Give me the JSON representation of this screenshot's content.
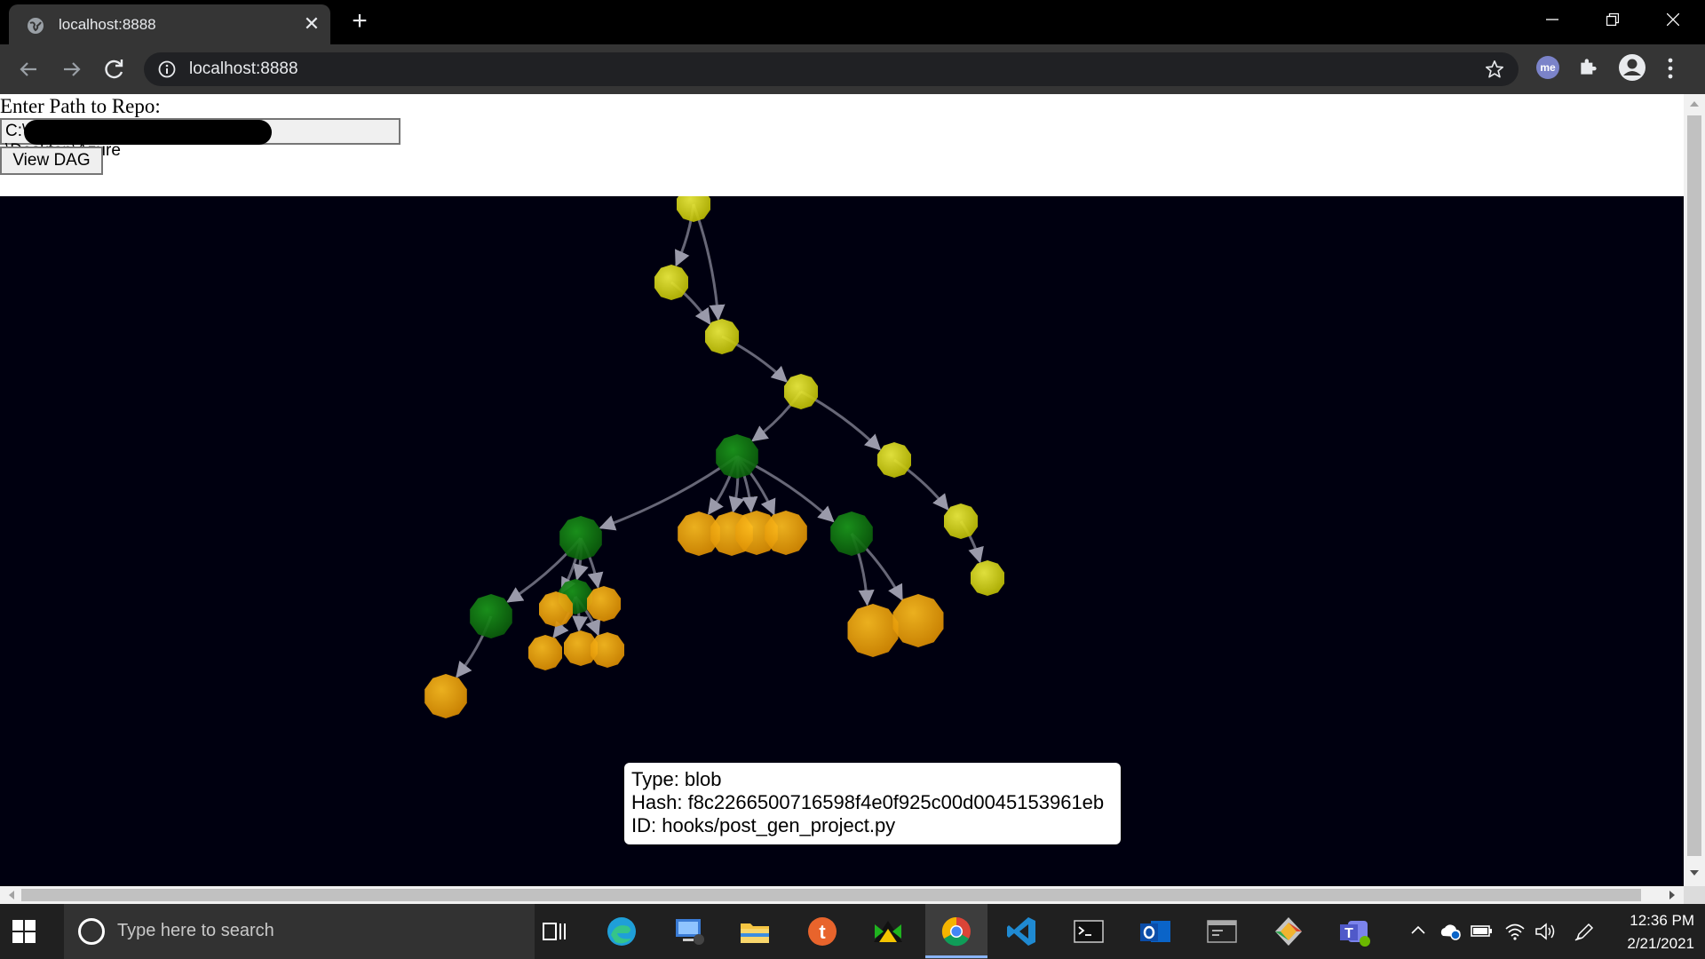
{
  "browser": {
    "tab_title": "localhost:8888",
    "url": "localhost:8888"
  },
  "page": {
    "form_label": "Enter Path to Repo:",
    "path_prefix": "C:\\",
    "path_suffix": "\\Desktop\\Azure",
    "button_label": "View DAG"
  },
  "graph": {
    "nodes": [
      {
        "id": "y1",
        "color": "yellow",
        "size": "small"
      },
      {
        "id": "y2",
        "color": "yellow",
        "size": "small"
      },
      {
        "id": "y3",
        "color": "yellow",
        "size": "small"
      },
      {
        "id": "y4",
        "color": "yellow",
        "size": "small"
      },
      {
        "id": "y5",
        "color": "yellow",
        "size": "small"
      },
      {
        "id": "y6",
        "color": "yellow",
        "size": "small"
      },
      {
        "id": "y7",
        "color": "yellow",
        "size": "small"
      },
      {
        "id": "g1",
        "color": "green",
        "size": "medium"
      },
      {
        "id": "g2",
        "color": "green",
        "size": "medium"
      },
      {
        "id": "g3",
        "color": "green",
        "size": "medium"
      },
      {
        "id": "g4",
        "color": "green",
        "size": "medium"
      },
      {
        "id": "g5",
        "color": "green",
        "size": "small"
      },
      {
        "id": "o1",
        "color": "orange",
        "size": "medium"
      },
      {
        "id": "o2",
        "color": "orange",
        "size": "medium"
      },
      {
        "id": "o3",
        "color": "orange",
        "size": "medium"
      },
      {
        "id": "o4",
        "color": "orange",
        "size": "medium"
      },
      {
        "id": "o5",
        "color": "orange",
        "size": "large"
      },
      {
        "id": "o6",
        "color": "orange",
        "size": "large"
      },
      {
        "id": "o7",
        "color": "orange",
        "size": "small"
      },
      {
        "id": "o8",
        "color": "orange",
        "size": "small"
      },
      {
        "id": "o9",
        "color": "orange",
        "size": "small"
      },
      {
        "id": "o10",
        "color": "orange",
        "size": "small"
      },
      {
        "id": "o11",
        "color": "orange",
        "size": "small"
      },
      {
        "id": "o12",
        "color": "orange",
        "size": "small"
      },
      {
        "id": "o13",
        "color": "orange",
        "size": "medium"
      }
    ],
    "edges": [
      [
        "y1",
        "y2"
      ],
      [
        "y1",
        "y3"
      ],
      [
        "y2",
        "y3"
      ],
      [
        "y3",
        "y4"
      ],
      [
        "y4",
        "g1"
      ],
      [
        "y4",
        "y5"
      ],
      [
        "y5",
        "y6"
      ],
      [
        "y6",
        "y7"
      ],
      [
        "g1",
        "g2"
      ],
      [
        "g1",
        "g3"
      ],
      [
        "g1",
        "o1"
      ],
      [
        "g1",
        "o2"
      ],
      [
        "g1",
        "o3"
      ],
      [
        "g1",
        "o4"
      ],
      [
        "g3",
        "o5"
      ],
      [
        "g3",
        "o6"
      ],
      [
        "g2",
        "g4"
      ],
      [
        "g2",
        "g5"
      ],
      [
        "g2",
        "o7"
      ],
      [
        "g2",
        "o8"
      ],
      [
        "g5",
        "o9"
      ],
      [
        "g5",
        "o10"
      ],
      [
        "g5",
        "o11"
      ],
      [
        "g4",
        "o13"
      ]
    ],
    "colors": {
      "yellow": "#d8d800",
      "green": "#0f7d0f",
      "orange": "#e8a000",
      "edge": "#8a8a9a",
      "background": "#000010"
    }
  },
  "tooltip": {
    "type_line": "Type: blob",
    "hash_line": "Hash: f8c2266500716598f4e0f925c00d0045153961eb",
    "id_line": "ID: hooks/post_gen_project.py"
  },
  "taskbar": {
    "search_placeholder": "Type here to search",
    "time": "12:36 PM",
    "date": "2/21/2021"
  }
}
